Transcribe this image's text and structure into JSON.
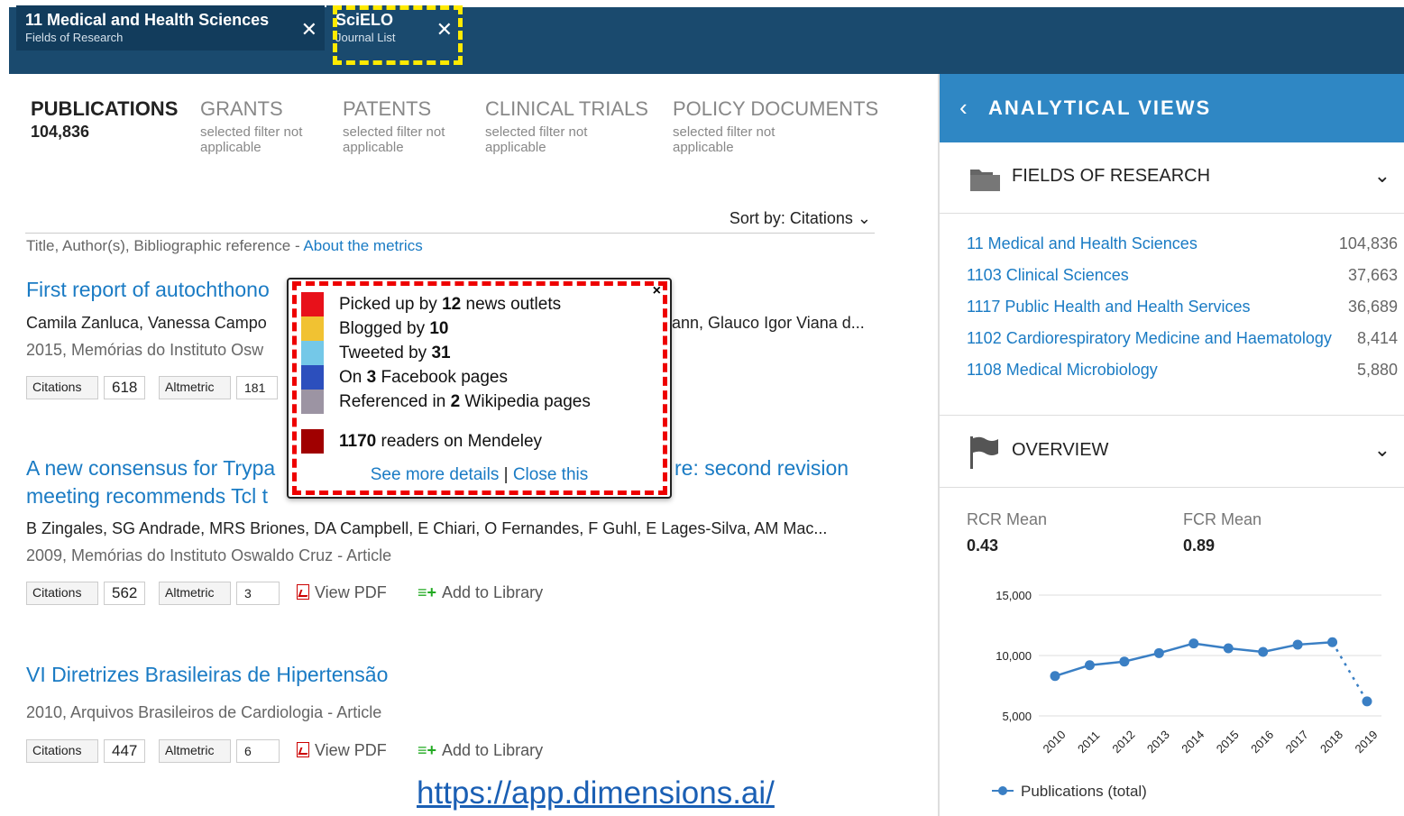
{
  "filters": [
    {
      "title": "11 Medical and Health Sciences",
      "subtitle": "Fields of Research"
    },
    {
      "title": "SciELO",
      "subtitle": "Journal List"
    }
  ],
  "tabs": {
    "publications": {
      "label": "PUBLICATIONS",
      "count": "104,836"
    },
    "grants": {
      "label": "GRANTS",
      "note": "selected filter not applicable"
    },
    "patents": {
      "label": "PATENTS",
      "note": "selected filter not applicable"
    },
    "clinical_trials": {
      "label": "CLINICAL TRIALS",
      "note": "selected filter not applicable"
    },
    "policy_documents": {
      "label": "POLICY DOCUMENTS",
      "note": "selected filter not applicable"
    }
  },
  "sort": {
    "label": "Sort by:",
    "value": "Citations"
  },
  "meta_line": {
    "text": "Title, Author(s), Bibliographic reference - ",
    "link": "About the metrics"
  },
  "publications": [
    {
      "title": "First report of autochthono",
      "authors": "Camila Zanluca, Vanessa Campo",
      "authors_tail": "ann, Glauco Igor Viana d...",
      "source": "2015, Memórias do Instituto Osw",
      "citations_label": "Citations",
      "citations": "618",
      "altmetric_label": "Altmetric",
      "altmetric": "181"
    },
    {
      "title_a": "A new consensus for Trypa",
      "title_b": "re: second revision",
      "title_c": "meeting recommends Tcl t",
      "authors": "B Zingales, SG Andrade, MRS Briones, DA Campbell, E Chiari, O Fernandes, F Guhl, E Lages-Silva, AM Mac...",
      "source": "2009, Memórias do Instituto Oswaldo Cruz - Article",
      "citations_label": "Citations",
      "citations": "562",
      "altmetric_label": "Altmetric",
      "altmetric": "3",
      "view_pdf": "View PDF",
      "add_library": "Add to Library"
    },
    {
      "title": "VI Diretrizes Brasileiras de Hipertensão",
      "source": "2010, Arquivos Brasileiros de Cardiologia - Article",
      "citations_label": "Citations",
      "citations": "447",
      "altmetric_label": "Altmetric",
      "altmetric": "6",
      "view_pdf": "View PDF",
      "add_library": "Add to Library"
    }
  ],
  "popup": {
    "close": "×",
    "rows": [
      {
        "pre": "Picked up by ",
        "num": "12",
        "post": " news outlets",
        "color": "#e8111a"
      },
      {
        "pre": "Blogged by ",
        "num": "10",
        "post": "",
        "color": "#f1c232"
      },
      {
        "pre": "Tweeted by ",
        "num": "31",
        "post": "",
        "color": "#74c8e8"
      },
      {
        "pre": "On ",
        "num": "3",
        "post": " Facebook pages",
        "color": "#2c4fbd"
      },
      {
        "pre": "Referenced in ",
        "num": "2",
        "post": " Wikipedia pages",
        "color": "#9c94a3"
      },
      {
        "pre": "",
        "num": "1170",
        "post": " readers on Mendeley",
        "color": "#a00000"
      }
    ],
    "see_more": "See more details",
    "separator": " | ",
    "close_this": "Close this"
  },
  "right_panel": {
    "header": "ANALYTICAL VIEWS",
    "fields_title": "FIELDS OF RESEARCH",
    "fields": [
      {
        "name": "11 Medical and Health Sciences",
        "value": "104,836"
      },
      {
        "name": "1103 Clinical Sciences",
        "value": "37,663"
      },
      {
        "name": "1117 Public Health and Health Services",
        "value": "36,689"
      },
      {
        "name": "1102 Cardiorespiratory Medicine and Haematology",
        "value": "8,414"
      },
      {
        "name": "1108 Medical Microbiology",
        "value": "5,880"
      }
    ],
    "overview_title": "OVERVIEW",
    "rcr_label": "RCR Mean",
    "rcr_value": "0.43",
    "fcr_label": "FCR Mean",
    "fcr_value": "0.89"
  },
  "chart_data": {
    "type": "line",
    "x": [
      "2010",
      "2011",
      "2012",
      "2013",
      "2014",
      "2015",
      "2016",
      "2017",
      "2018",
      "2019"
    ],
    "series": [
      {
        "name": "Publications (total)",
        "values": [
          8300,
          9200,
          9500,
          10200,
          11000,
          10600,
          10300,
          10900,
          11100,
          6200
        ],
        "color": "#3a7fc4"
      }
    ],
    "y_ticks": [
      "15,000",
      "10,000",
      "5,000"
    ],
    "y_tick_values": [
      15000,
      10000,
      5000
    ],
    "ylim": [
      5000,
      15000
    ],
    "dashed_last_segment": true,
    "legend_position": "bottom-left"
  },
  "footer_url": "https://app.dimensions.ai/"
}
